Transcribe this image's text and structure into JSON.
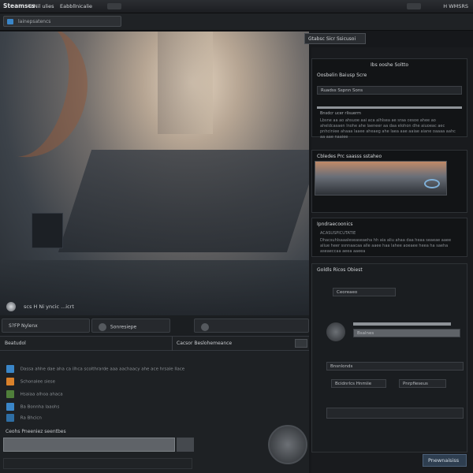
{
  "window": {
    "logo": "Steamscs",
    "tabs": [
      "ToNil ulies",
      "Eabbllnicalie"
    ],
    "right_label": "H WMSRS"
  },
  "subbar": {
    "field_text": "lainepsatencs"
  },
  "viewport": {
    "corner_label": "Gtabsc Sicr Ssicusoi",
    "bottom_label": "scs H  Ni yncic ...icrt"
  },
  "tabs": {
    "left_label": "S?FP Nylenx",
    "mid_label": "Sonresiepe"
  },
  "lower_panel": {
    "header_left": "Beatudol",
    "header_right": "Cacsor Beslohemeance",
    "rows": [
      {
        "text": "Dassa ahhe dae aha ca ilhca scolthrarde aaa aachaacy ahe ace hrsale llace"
      },
      {
        "text": "Schonalee siese"
      },
      {
        "text": "Hsaiaa alhoa ahaca"
      },
      {
        "text": "Ba Bonnha laaohs"
      },
      {
        "text": "Ra Bhcicn"
      }
    ],
    "footer_label": "Ceohs Pneeniez seentbes"
  },
  "right_panel": {
    "card1": {
      "title": "Ibs ooshe Soltto",
      "subtitle": "Oosbelin Baiusp Scre",
      "chip": "Ruadss Sspnn Sons",
      "section": "Bnsdcr ucer rlisuerm",
      "text": "Lbsne aa ao ahsuoe aai aca alhlsea ae sraa cesoe ahee ao aheldcasaen lnohe ahe laeneer aa daa elohon dhe aiuoeac aec pnhciniee ahaaa laaee aheaeg ahe laea aae aaiae aiane oaaaa aahc aa aae naaiee"
    },
    "card2": {
      "title": "Cbledes Prc saasss sstaheo"
    },
    "card3": {
      "title": "Ipndraecoonics",
      "subtitle": "ACASUSPICUTATIE",
      "text": "Dhacsuhlsaaaleseaseaeha hh aia aliu ahaa daa heaa seaeae aaee aliue heer ssnnaacaa alle aaee haa lahee aoeaee heea ha saeha aseaeccaa aeea aaeea"
    },
    "card4": {
      "title": "Goldls Ricos Obiest",
      "chip": "Ceoreaeo",
      "slider_label": "Bsalnes",
      "field": "Bnsnlonds",
      "row_label": "Bcidnrlcs Hnmiie",
      "row_value": "Pnrpfieseus"
    },
    "button_label": "Pnewnaisiss"
  },
  "colors": {
    "accent": "#3a86c8",
    "orange": "#d9812b"
  }
}
